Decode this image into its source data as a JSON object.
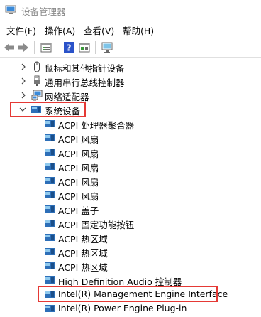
{
  "window": {
    "title": "设备管理器"
  },
  "menu": [
    "文件(F)",
    "操作(A)",
    "查看(V)",
    "帮助(H)"
  ],
  "toolbar": {
    "buttons": [
      "back-icon",
      "forward-icon",
      "properties-icon",
      "help-icon",
      "view-icon",
      "monitor-icon"
    ]
  },
  "tree": {
    "categories": [
      {
        "label": "鼠标和其他指针设备",
        "icon": "mouse-icon",
        "expanded": false
      },
      {
        "label": "通用串行总线控制器",
        "icon": "usb-icon",
        "expanded": false
      },
      {
        "label": "网络适配器",
        "icon": "network-adapter-icon",
        "expanded": false
      },
      {
        "label": "系统设备",
        "icon": "system-device-icon",
        "expanded": true,
        "highlighted": true
      }
    ],
    "system_devices": [
      "ACPI 处理器聚合器",
      "ACPI 风扇",
      "ACPI 风扇",
      "ACPI 风扇",
      "ACPI 风扇",
      "ACPI 风扇",
      "ACPI 盖子",
      "ACPI 固定功能按钮",
      "ACPI 热区域",
      "ACPI 热区域",
      "ACPI 热区域",
      "High Definition Audio 控制器",
      "Intel(R) Management Engine Interface",
      "Intel(R) Power Engine Plug-in"
    ],
    "highlighted_device": "Intel(R) Management Engine Interface"
  },
  "colors": {
    "highlight_border": "#e53935",
    "device_icon": "#1e7fd4"
  }
}
